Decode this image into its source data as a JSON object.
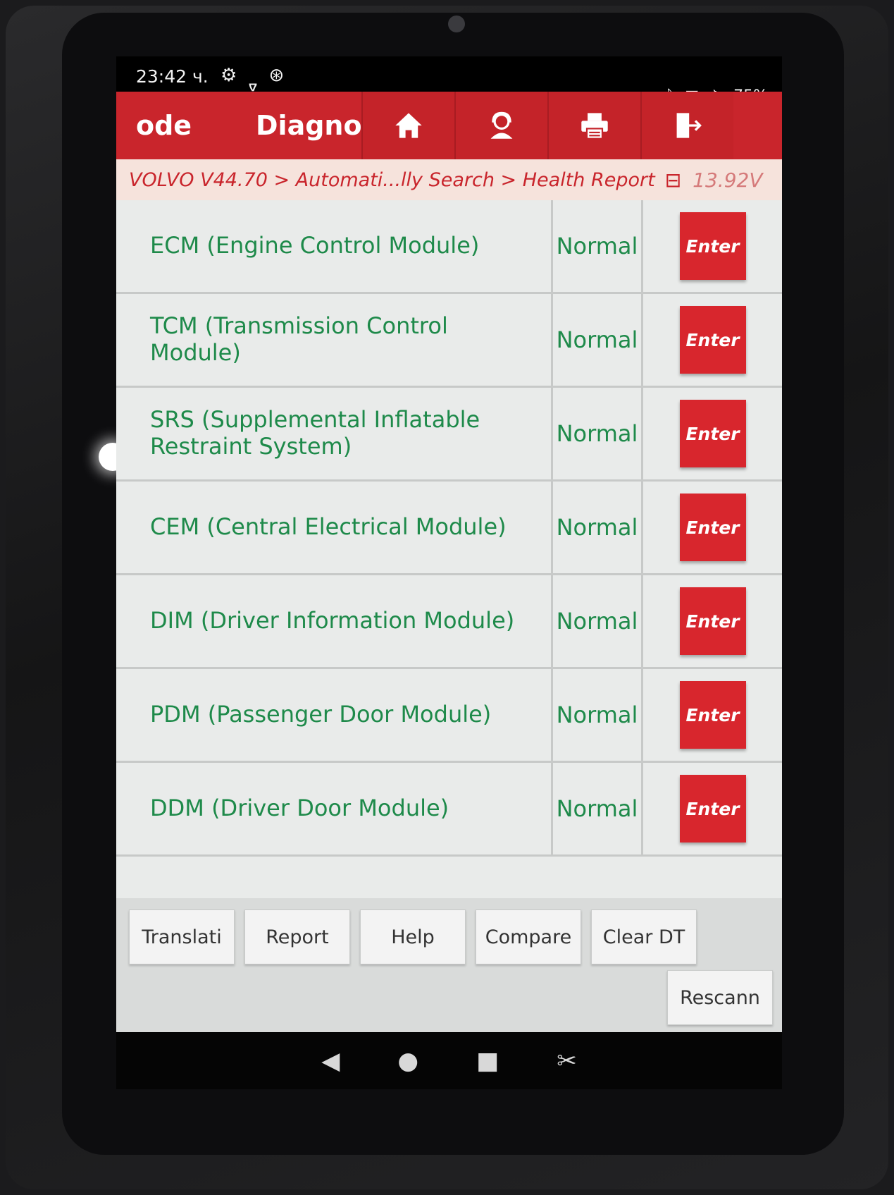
{
  "status_bar": {
    "time": "23:42 ч.",
    "left_icons": [
      "gear-icon",
      "stethoscope-icon",
      "bluetooth-ring-icon"
    ],
    "battery": "75%"
  },
  "header": {
    "tabs": [
      "ode",
      "Diagnos"
    ],
    "buttons": [
      "home-icon",
      "support-icon",
      "print-icon",
      "exit-icon"
    ],
    "accent_color": "#c9252c"
  },
  "breadcrumb": {
    "path": "VOLVO V44.70 > Automati...lly Search > Health Report",
    "voltage": "13.92V"
  },
  "modules": [
    {
      "name": "ECM (Engine Control Module)",
      "status": "Normal",
      "action": "Enter"
    },
    {
      "name": "TCM (Transmission Control Module)",
      "status": "Normal",
      "action": "Enter"
    },
    {
      "name": "SRS (Supplemental Inflatable Restraint System)",
      "status": "Normal",
      "action": "Enter"
    },
    {
      "name": "CEM (Central Electrical Module)",
      "status": "Normal",
      "action": "Enter"
    },
    {
      "name": "DIM (Driver Information Module)",
      "status": "Normal",
      "action": "Enter"
    },
    {
      "name": "PDM (Passenger Door Module)",
      "status": "Normal",
      "action": "Enter"
    },
    {
      "name": "DDM (Driver Door Module)",
      "status": "Normal",
      "action": "Enter"
    }
  ],
  "bottom_buttons": {
    "translate": "Translati",
    "report": "Report",
    "help": "Help",
    "compare": "Compare",
    "clear_dtc": "Clear DT",
    "rescan": "Rescann"
  },
  "nav_bar": [
    "back-icon",
    "home-circle-icon",
    "recents-icon",
    "screenshot-icon"
  ]
}
